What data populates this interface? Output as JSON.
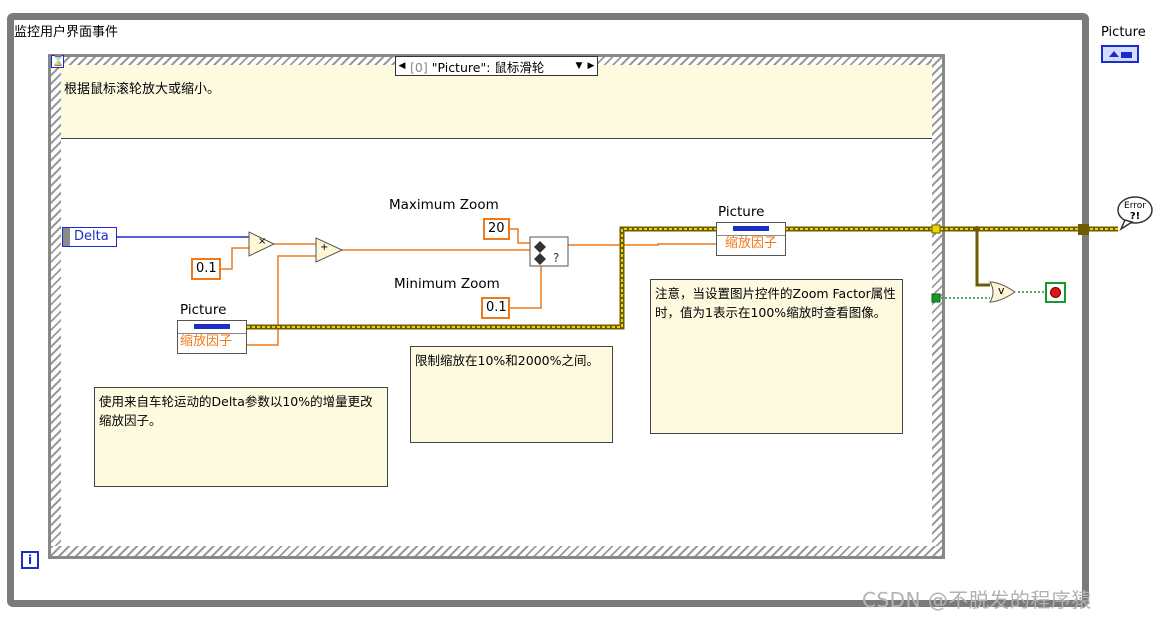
{
  "loop": {
    "title": "监控用户界面事件",
    "iteration_label": "i"
  },
  "event_structure": {
    "case_selector": {
      "index": "[0]",
      "label": "\"Picture\": 鼠标滑轮"
    },
    "event_description": "根据鼠标滚轮放大或缩小。"
  },
  "nodes": {
    "delta": "Delta",
    "factor_constant": "0.1",
    "max_zoom_label": "Maximum Zoom",
    "max_zoom_value": "20",
    "min_zoom_label": "Minimum Zoom",
    "min_zoom_value": "0.1",
    "multiply_symbol": "×",
    "add_symbol": "+",
    "or_symbol": "v",
    "property_read": {
      "label": "Picture",
      "field": "缩放因子"
    },
    "property_write": {
      "label": "Picture",
      "field": "缩放因子"
    }
  },
  "comments": {
    "delta_comment": "使用来自车轮运动的Delta参数以10%的增量更改缩放因子。",
    "limit_comment": "限制缩放在10%和2000%之间。",
    "note_comment": "注意，当设置图片控件的Zoom Factor属性时，值为1表示在100%缩放时查看图像。"
  },
  "terminals": {
    "picture_control_label": "Picture",
    "error_label": "Error"
  },
  "watermark": "CSDN @不脱发的程序猿",
  "colors": {
    "wire_numeric": "#f07a1a",
    "wire_int": "#1b2dc8",
    "wire_error": "#7a6a0a",
    "comment_bg": "#fdfae0"
  }
}
